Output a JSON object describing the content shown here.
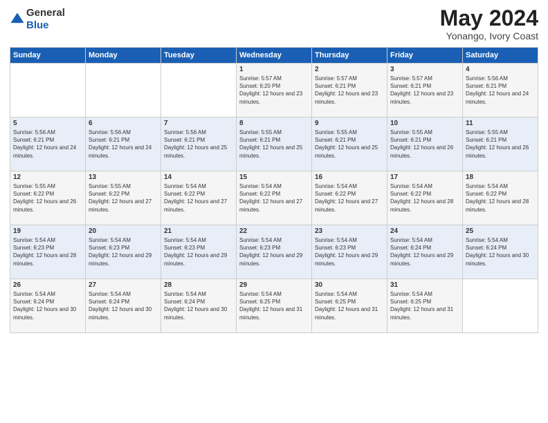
{
  "logo": {
    "text_general": "General",
    "text_blue": "Blue"
  },
  "header": {
    "title": "May 2024",
    "subtitle": "Yonango, Ivory Coast"
  },
  "weekdays": [
    "Sunday",
    "Monday",
    "Tuesday",
    "Wednesday",
    "Thursday",
    "Friday",
    "Saturday"
  ],
  "weeks": [
    [
      {
        "day": "",
        "sunrise": "",
        "sunset": "",
        "daylight": ""
      },
      {
        "day": "",
        "sunrise": "",
        "sunset": "",
        "daylight": ""
      },
      {
        "day": "",
        "sunrise": "",
        "sunset": "",
        "daylight": ""
      },
      {
        "day": "1",
        "sunrise": "Sunrise: 5:57 AM",
        "sunset": "Sunset: 6:20 PM",
        "daylight": "Daylight: 12 hours and 23 minutes."
      },
      {
        "day": "2",
        "sunrise": "Sunrise: 5:57 AM",
        "sunset": "Sunset: 6:21 PM",
        "daylight": "Daylight: 12 hours and 23 minutes."
      },
      {
        "day": "3",
        "sunrise": "Sunrise: 5:57 AM",
        "sunset": "Sunset: 6:21 PM",
        "daylight": "Daylight: 12 hours and 23 minutes."
      },
      {
        "day": "4",
        "sunrise": "Sunrise: 5:56 AM",
        "sunset": "Sunset: 6:21 PM",
        "daylight": "Daylight: 12 hours and 24 minutes."
      }
    ],
    [
      {
        "day": "5",
        "sunrise": "Sunrise: 5:56 AM",
        "sunset": "Sunset: 6:21 PM",
        "daylight": "Daylight: 12 hours and 24 minutes."
      },
      {
        "day": "6",
        "sunrise": "Sunrise: 5:56 AM",
        "sunset": "Sunset: 6:21 PM",
        "daylight": "Daylight: 12 hours and 24 minutes."
      },
      {
        "day": "7",
        "sunrise": "Sunrise: 5:56 AM",
        "sunset": "Sunset: 6:21 PM",
        "daylight": "Daylight: 12 hours and 25 minutes."
      },
      {
        "day": "8",
        "sunrise": "Sunrise: 5:55 AM",
        "sunset": "Sunset: 6:21 PM",
        "daylight": "Daylight: 12 hours and 25 minutes."
      },
      {
        "day": "9",
        "sunrise": "Sunrise: 5:55 AM",
        "sunset": "Sunset: 6:21 PM",
        "daylight": "Daylight: 12 hours and 25 minutes."
      },
      {
        "day": "10",
        "sunrise": "Sunrise: 5:55 AM",
        "sunset": "Sunset: 6:21 PM",
        "daylight": "Daylight: 12 hours and 26 minutes."
      },
      {
        "day": "11",
        "sunrise": "Sunrise: 5:55 AM",
        "sunset": "Sunset: 6:21 PM",
        "daylight": "Daylight: 12 hours and 26 minutes."
      }
    ],
    [
      {
        "day": "12",
        "sunrise": "Sunrise: 5:55 AM",
        "sunset": "Sunset: 6:22 PM",
        "daylight": "Daylight: 12 hours and 26 minutes."
      },
      {
        "day": "13",
        "sunrise": "Sunrise: 5:55 AM",
        "sunset": "Sunset: 6:22 PM",
        "daylight": "Daylight: 12 hours and 27 minutes."
      },
      {
        "day": "14",
        "sunrise": "Sunrise: 5:54 AM",
        "sunset": "Sunset: 6:22 PM",
        "daylight": "Daylight: 12 hours and 27 minutes."
      },
      {
        "day": "15",
        "sunrise": "Sunrise: 5:54 AM",
        "sunset": "Sunset: 6:22 PM",
        "daylight": "Daylight: 12 hours and 27 minutes."
      },
      {
        "day": "16",
        "sunrise": "Sunrise: 5:54 AM",
        "sunset": "Sunset: 6:22 PM",
        "daylight": "Daylight: 12 hours and 27 minutes."
      },
      {
        "day": "17",
        "sunrise": "Sunrise: 5:54 AM",
        "sunset": "Sunset: 6:22 PM",
        "daylight": "Daylight: 12 hours and 28 minutes."
      },
      {
        "day": "18",
        "sunrise": "Sunrise: 5:54 AM",
        "sunset": "Sunset: 6:22 PM",
        "daylight": "Daylight: 12 hours and 28 minutes."
      }
    ],
    [
      {
        "day": "19",
        "sunrise": "Sunrise: 5:54 AM",
        "sunset": "Sunset: 6:23 PM",
        "daylight": "Daylight: 12 hours and 28 minutes."
      },
      {
        "day": "20",
        "sunrise": "Sunrise: 5:54 AM",
        "sunset": "Sunset: 6:23 PM",
        "daylight": "Daylight: 12 hours and 29 minutes."
      },
      {
        "day": "21",
        "sunrise": "Sunrise: 5:54 AM",
        "sunset": "Sunset: 6:23 PM",
        "daylight": "Daylight: 12 hours and 29 minutes."
      },
      {
        "day": "22",
        "sunrise": "Sunrise: 5:54 AM",
        "sunset": "Sunset: 6:23 PM",
        "daylight": "Daylight: 12 hours and 29 minutes."
      },
      {
        "day": "23",
        "sunrise": "Sunrise: 5:54 AM",
        "sunset": "Sunset: 6:23 PM",
        "daylight": "Daylight: 12 hours and 29 minutes."
      },
      {
        "day": "24",
        "sunrise": "Sunrise: 5:54 AM",
        "sunset": "Sunset: 6:24 PM",
        "daylight": "Daylight: 12 hours and 29 minutes."
      },
      {
        "day": "25",
        "sunrise": "Sunrise: 5:54 AM",
        "sunset": "Sunset: 6:24 PM",
        "daylight": "Daylight: 12 hours and 30 minutes."
      }
    ],
    [
      {
        "day": "26",
        "sunrise": "Sunrise: 5:54 AM",
        "sunset": "Sunset: 6:24 PM",
        "daylight": "Daylight: 12 hours and 30 minutes."
      },
      {
        "day": "27",
        "sunrise": "Sunrise: 5:54 AM",
        "sunset": "Sunset: 6:24 PM",
        "daylight": "Daylight: 12 hours and 30 minutes."
      },
      {
        "day": "28",
        "sunrise": "Sunrise: 5:54 AM",
        "sunset": "Sunset: 6:24 PM",
        "daylight": "Daylight: 12 hours and 30 minutes."
      },
      {
        "day": "29",
        "sunrise": "Sunrise: 5:54 AM",
        "sunset": "Sunset: 6:25 PM",
        "daylight": "Daylight: 12 hours and 31 minutes."
      },
      {
        "day": "30",
        "sunrise": "Sunrise: 5:54 AM",
        "sunset": "Sunset: 6:25 PM",
        "daylight": "Daylight: 12 hours and 31 minutes."
      },
      {
        "day": "31",
        "sunrise": "Sunrise: 5:54 AM",
        "sunset": "Sunset: 6:25 PM",
        "daylight": "Daylight: 12 hours and 31 minutes."
      },
      {
        "day": "",
        "sunrise": "",
        "sunset": "",
        "daylight": ""
      }
    ]
  ]
}
